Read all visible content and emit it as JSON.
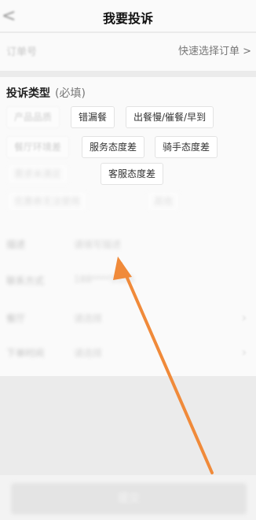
{
  "header": {
    "back_icon": "<",
    "title": "我要投诉"
  },
  "order": {
    "label": "订单号",
    "quick_select": "快速选择订单 >"
  },
  "complaint": {
    "title": "投诉类型",
    "required": "(必填)",
    "tags": [
      {
        "label": "产品品质"
      },
      {
        "label": "错漏餐"
      },
      {
        "label": "出餐慢/催餐/早到"
      },
      {
        "label": "餐厅环境差"
      },
      {
        "label": "服务态度差"
      },
      {
        "label": "骑手态度差"
      },
      {
        "label": "需求未满足"
      },
      {
        "label": "客服态度差"
      },
      {
        "label": "优惠券无法使用"
      },
      {
        "label": "其他"
      }
    ]
  },
  "form": [
    {
      "label": "描述",
      "value": "请填写描述"
    },
    {
      "label": "联系方式",
      "value": "188****5555"
    },
    {
      "label": "餐厅",
      "value": "请选择"
    },
    {
      "label": "下单时间",
      "value": "请选择"
    }
  ],
  "submit": {
    "label": "提交"
  },
  "annotation": {
    "color": "#f08a3a"
  }
}
